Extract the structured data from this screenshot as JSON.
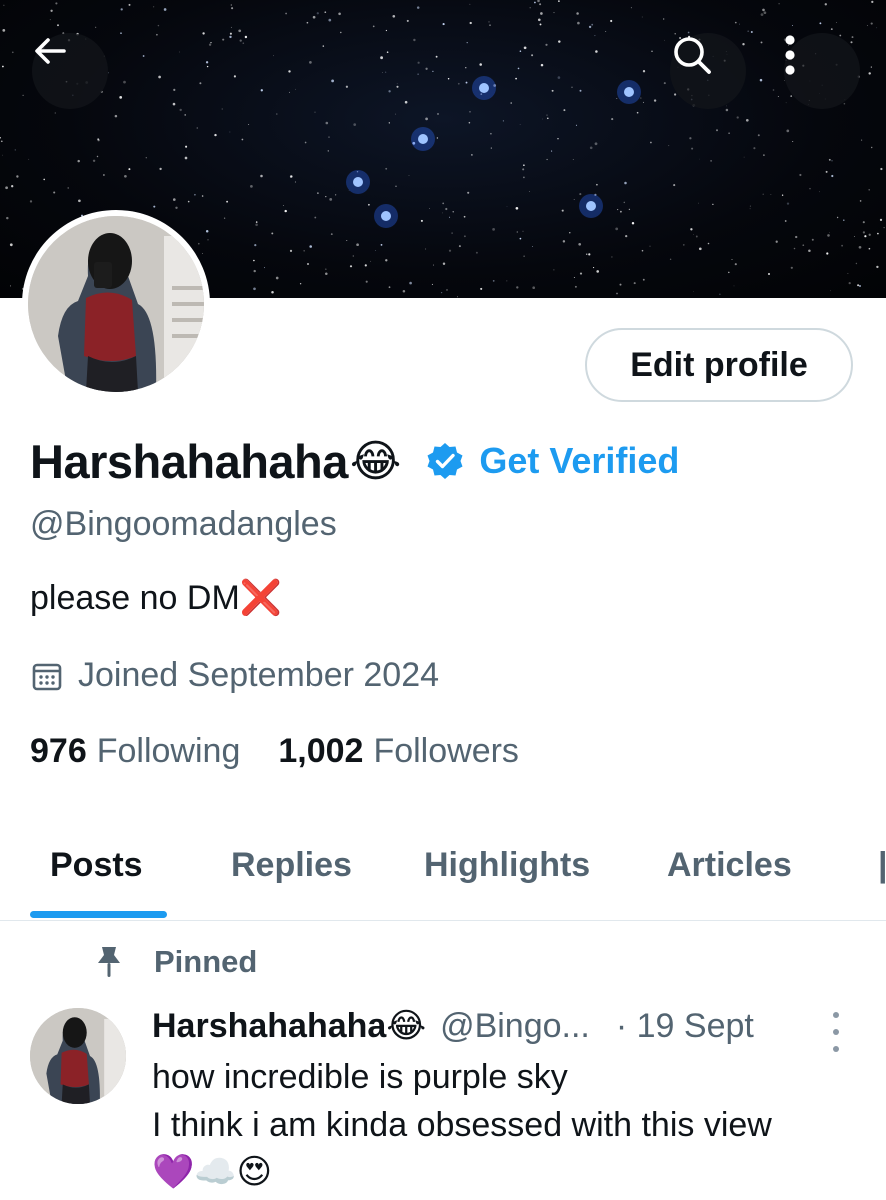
{
  "header": {
    "back_icon": "arrow-left-icon",
    "search_icon": "search-icon",
    "more_icon": "more-vertical-icon"
  },
  "profile": {
    "display_name": "Harshahahaha",
    "name_emoji": "😂",
    "verified_icon": "verified-badge-icon",
    "get_verified_label": "Get Verified",
    "handle": "@Bingoomadangles",
    "bio": "please no DM❌",
    "joined": "Joined September 2024",
    "edit_profile_label": "Edit profile",
    "following_count": "976",
    "following_label": "Following",
    "followers_count": "1,002",
    "followers_label": "Followers"
  },
  "tabs": [
    {
      "label": "Posts",
      "active": true
    },
    {
      "label": "Replies",
      "active": false
    },
    {
      "label": "Highlights",
      "active": false
    },
    {
      "label": "Articles",
      "active": false
    }
  ],
  "pinned_post": {
    "pinned_label": "Pinned",
    "author_name": "Harshahahaha",
    "author_emoji": "😂",
    "author_handle": "@Bingo...",
    "time": "· 19 Sept",
    "lines": [
      "how incredible is purple sky",
      "I think i am kinda obsessed with this view",
      "💜☁️😍"
    ]
  },
  "colors": {
    "accent": "#1d9bf0",
    "text_primary": "#0f1419",
    "text_secondary": "#536471"
  }
}
